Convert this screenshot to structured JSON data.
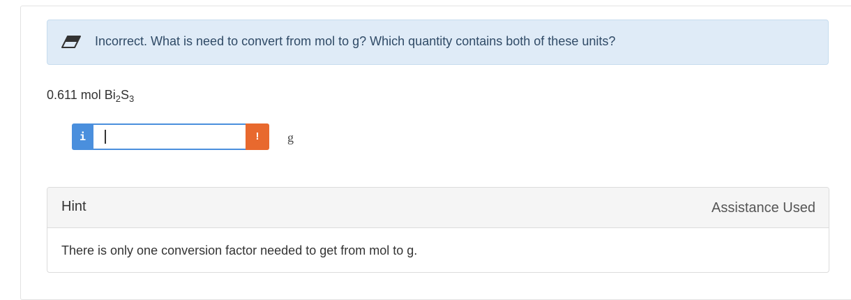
{
  "alert": {
    "icon": "eraser-icon",
    "message": "Incorrect. What is need to convert from mol to g? Which quantity contains both of these units?"
  },
  "given": {
    "amount": "0.611 mol Bi",
    "sub1": "2",
    "mid": "S",
    "sub2": "3"
  },
  "answer": {
    "info_label": "i",
    "value": "",
    "warn_label": "!",
    "unit": "g"
  },
  "hint": {
    "title": "Hint",
    "status": "Assistance Used",
    "text": "There is only one conversion factor needed to get from mol to g."
  },
  "colors": {
    "alert_bg": "#dfebf7",
    "info_blue": "#4a8fdd",
    "warn_orange": "#e8692e"
  }
}
